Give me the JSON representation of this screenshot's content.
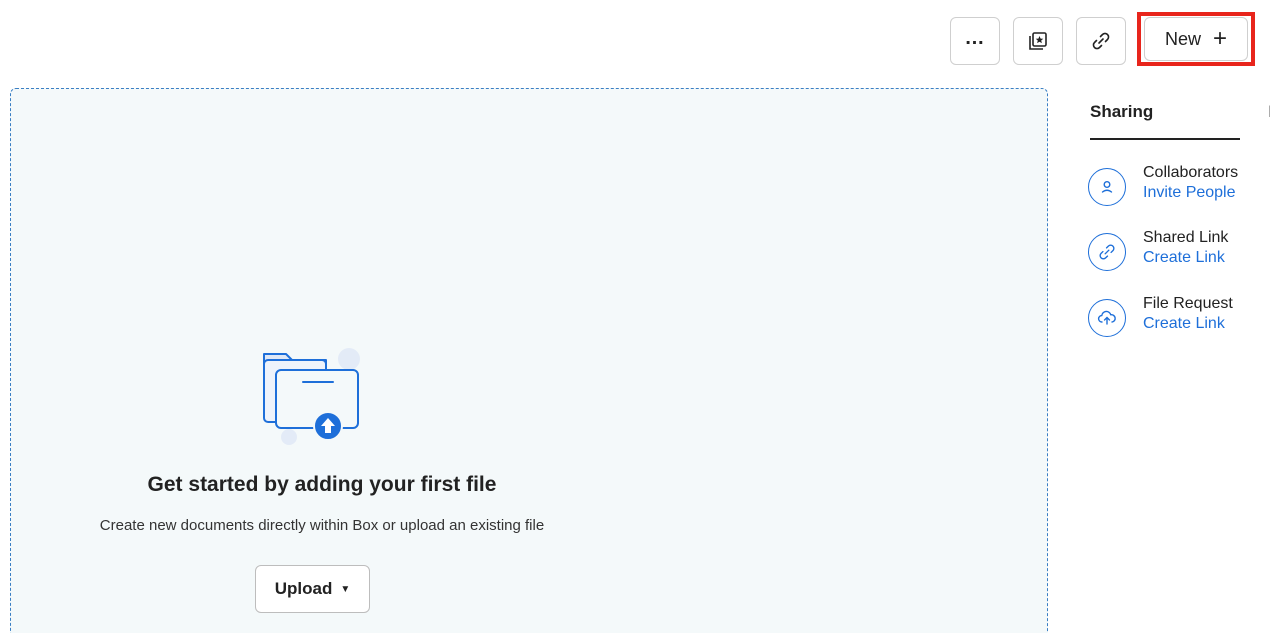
{
  "toolbar": {
    "more_label": "…",
    "new_label": "New",
    "new_icon": "plus-icon",
    "collections_icon": "star-collection-icon",
    "link_icon": "link-icon"
  },
  "empty_state": {
    "title": "Get started by adding your first file",
    "subtitle": "Create new documents directly within Box or upload an existing file",
    "upload_label": "Upload",
    "illustration": "folder-upload-icon"
  },
  "sidebar": {
    "tabs": [
      {
        "label": "Sharing",
        "active": true
      },
      {
        "label": "De",
        "active": false
      }
    ],
    "items": [
      {
        "label": "Collaborators",
        "action": "Invite People",
        "icon": "person-icon"
      },
      {
        "label": "Shared Link",
        "action": "Create Link",
        "icon": "link-icon"
      },
      {
        "label": "File Request",
        "action": "Create Link",
        "icon": "cloud-upload-icon"
      }
    ]
  },
  "colors": {
    "accent": "#1e6fd9",
    "highlight": "#e8251c",
    "dropzone_bg": "#f4f9fa"
  }
}
